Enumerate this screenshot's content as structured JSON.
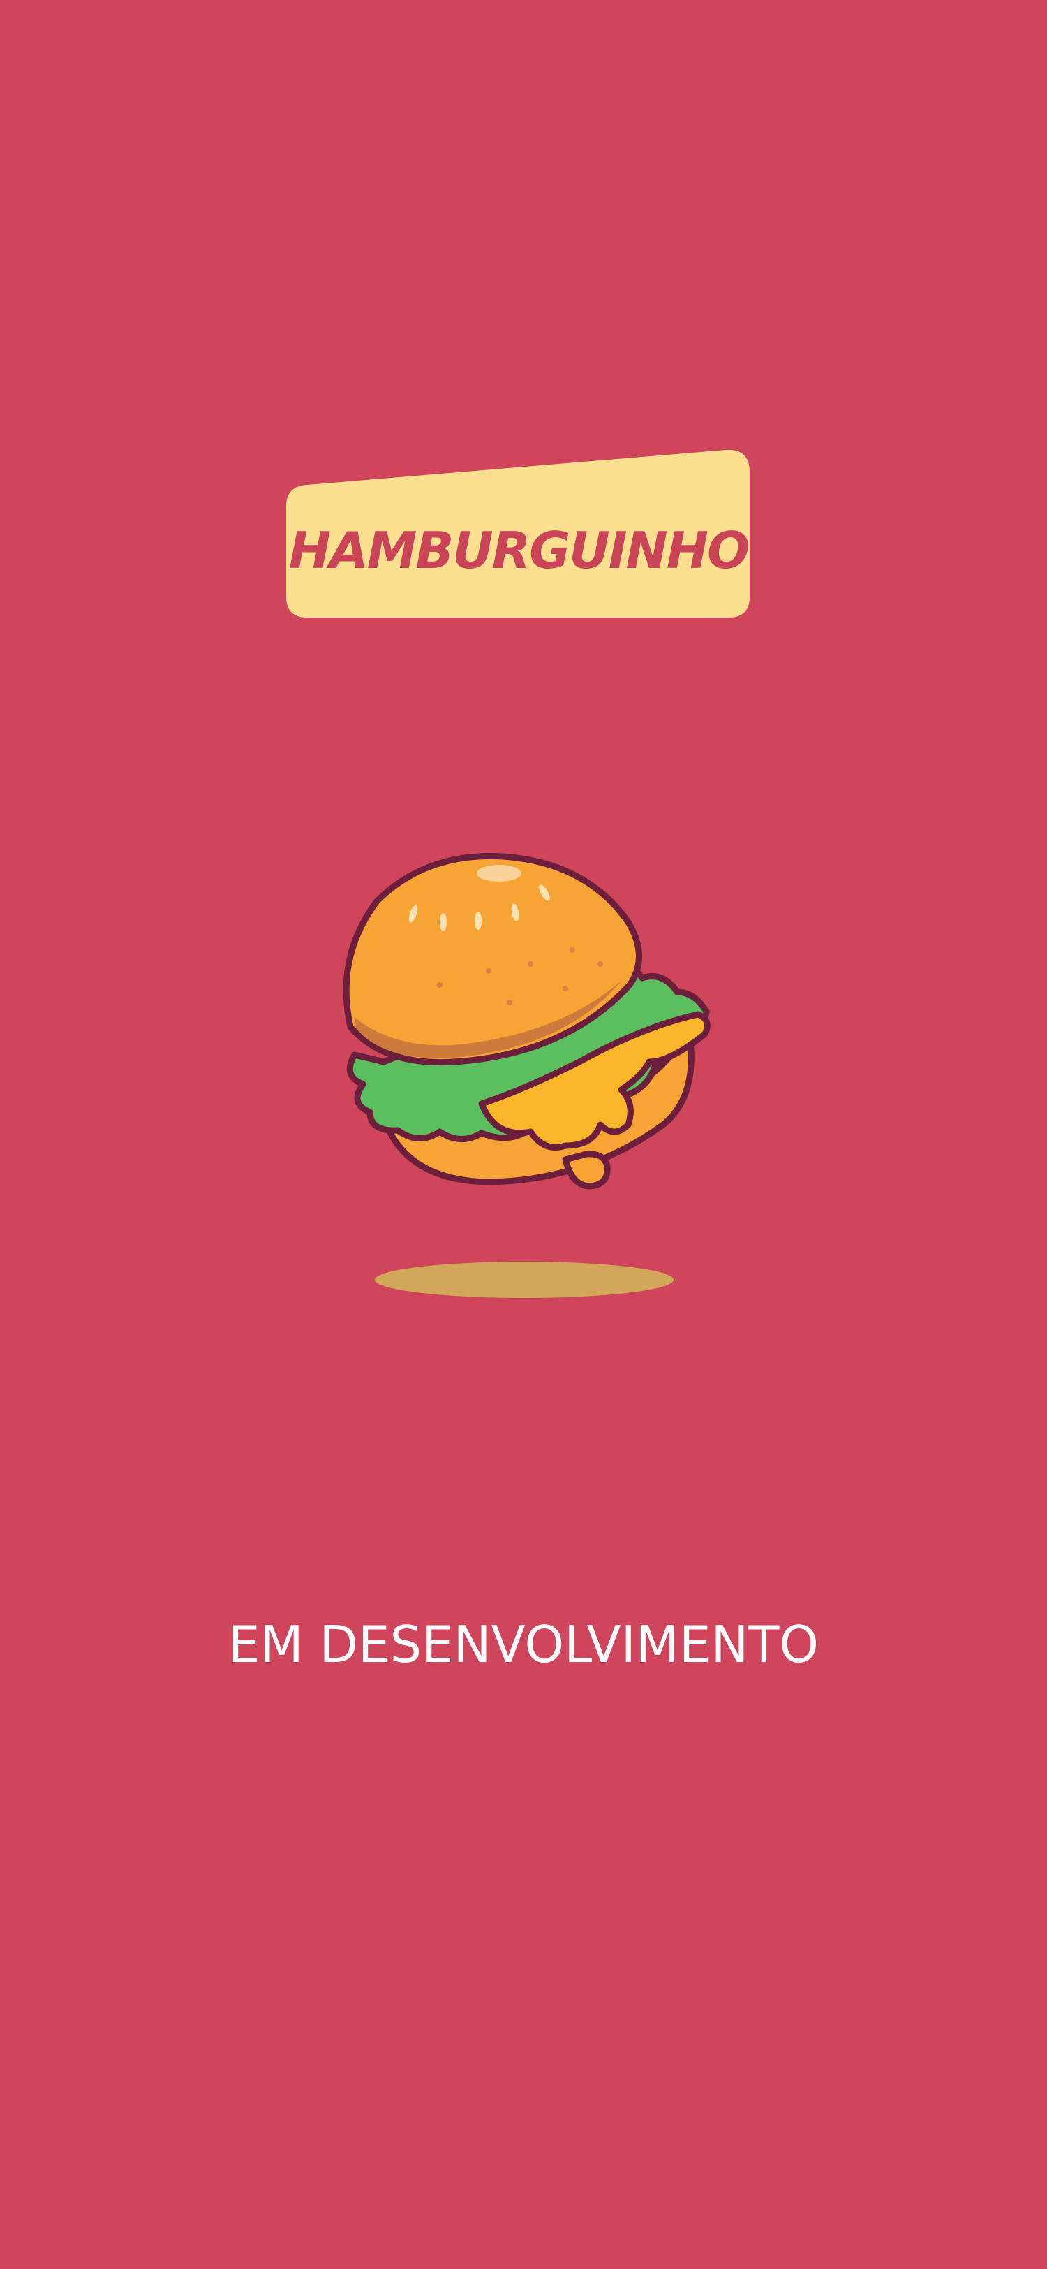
{
  "app": {
    "logo_text": "HAMBURGUINHO",
    "status_text": "EM DESENVOLVIMENTO"
  },
  "icons": {
    "illustration": "hamburger-illustration",
    "shadow": "floating-shadow"
  },
  "colors": {
    "background": "#cf455b",
    "badge": "#fde08f",
    "logo_text": "#c94457",
    "shadow": "#d1a85a",
    "status_text": "#ffffff"
  }
}
